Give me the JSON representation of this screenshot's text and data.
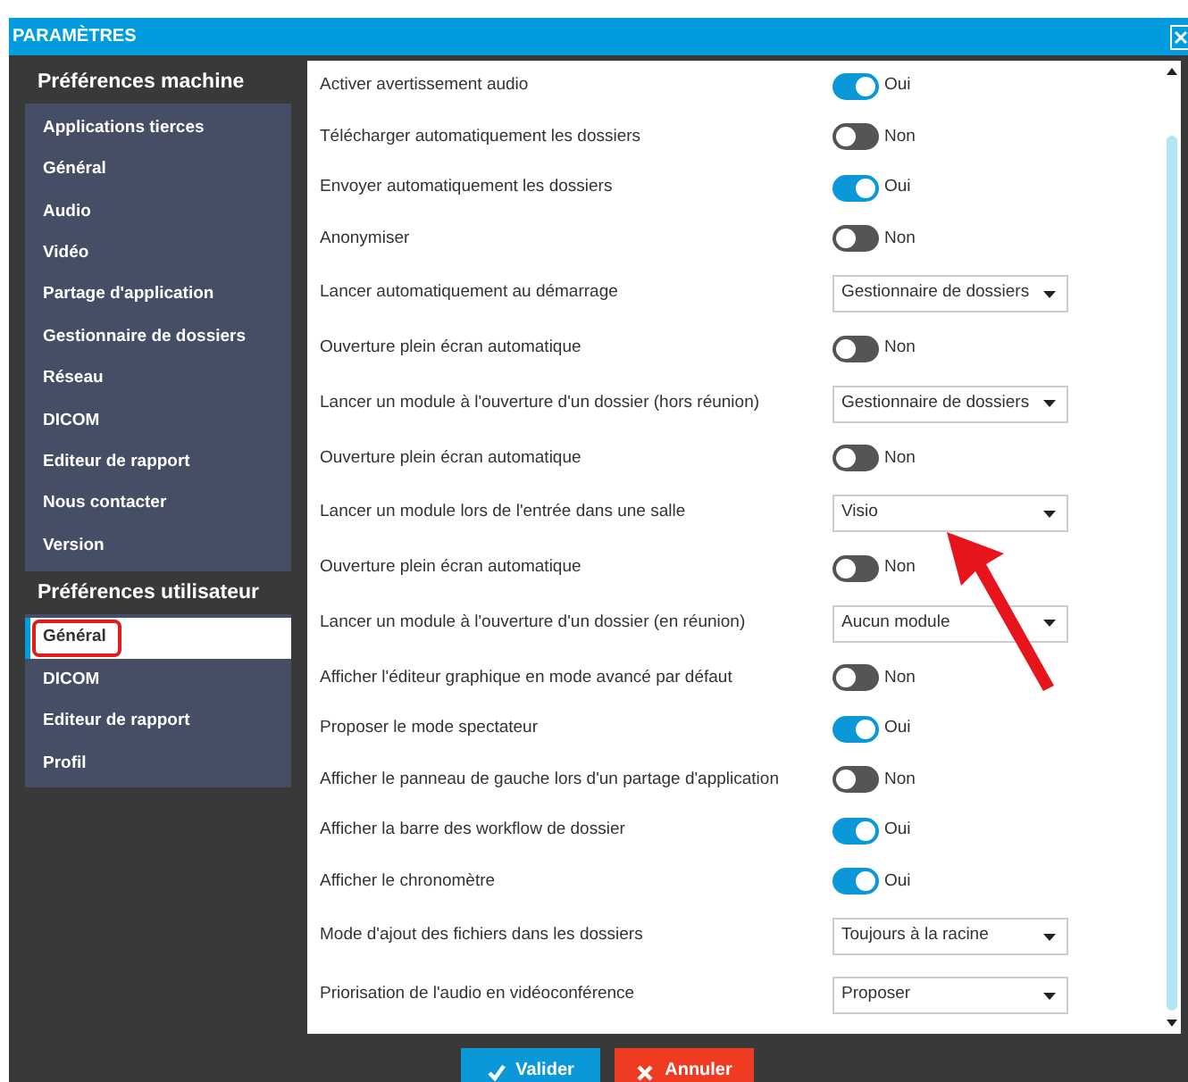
{
  "window": {
    "title": "PARAMÈTRES"
  },
  "sidebar": {
    "sections": [
      {
        "title": "Préférences machine",
        "items": [
          {
            "label": "Applications tierces",
            "selected": false
          },
          {
            "label": "Général",
            "selected": false
          },
          {
            "label": "Audio",
            "selected": false
          },
          {
            "label": "Vidéo",
            "selected": false
          },
          {
            "label": "Partage d'application",
            "selected": false
          },
          {
            "label": "Gestionnaire de dossiers",
            "selected": false
          },
          {
            "label": "Réseau",
            "selected": false
          },
          {
            "label": "DICOM",
            "selected": false
          },
          {
            "label": "Editeur de rapport",
            "selected": false
          },
          {
            "label": "Nous contacter",
            "selected": false
          },
          {
            "label": "Version",
            "selected": false
          }
        ]
      },
      {
        "title": "Préférences utilisateur",
        "items": [
          {
            "label": "Général",
            "selected": true
          },
          {
            "label": "DICOM",
            "selected": false
          },
          {
            "label": "Editeur de rapport",
            "selected": false
          },
          {
            "label": "Profil",
            "selected": false
          }
        ]
      }
    ]
  },
  "settings": [
    {
      "label": "Activer avertissement audio",
      "kind": "toggle",
      "on": true,
      "state_text": "Oui"
    },
    {
      "label": "Télécharger automatiquement les dossiers",
      "kind": "toggle",
      "on": false,
      "state_text": "Non"
    },
    {
      "label": "Envoyer automatiquement les dossiers",
      "kind": "toggle",
      "on": true,
      "state_text": "Oui"
    },
    {
      "label": "Anonymiser",
      "kind": "toggle",
      "on": false,
      "state_text": "Non"
    },
    {
      "label": "Lancer automatiquement au démarrage",
      "kind": "select",
      "value": "Gestionnaire de dossiers"
    },
    {
      "label": "Ouverture plein écran automatique",
      "kind": "toggle",
      "on": false,
      "state_text": "Non"
    },
    {
      "label": "Lancer un module à l'ouverture d'un dossier (hors réunion)",
      "kind": "select",
      "value": "Gestionnaire de dossiers"
    },
    {
      "label": "Ouverture plein écran automatique",
      "kind": "toggle",
      "on": false,
      "state_text": "Non"
    },
    {
      "label": "Lancer un module lors de l'entrée dans une salle",
      "kind": "select",
      "value": "Visio"
    },
    {
      "label": "Ouverture plein écran automatique",
      "kind": "toggle",
      "on": false,
      "state_text": "Non"
    },
    {
      "label": "Lancer un module à l'ouverture d'un dossier (en réunion)",
      "kind": "select",
      "value": "Aucun module"
    },
    {
      "label": "Afficher l'éditeur graphique en mode avancé par défaut",
      "kind": "toggle",
      "on": false,
      "state_text": "Non"
    },
    {
      "label": "Proposer le mode spectateur",
      "kind": "toggle",
      "on": true,
      "state_text": "Oui"
    },
    {
      "label": "Afficher le panneau de gauche lors d'un partage d'application",
      "kind": "toggle",
      "on": false,
      "state_text": "Non"
    },
    {
      "label": "Afficher la barre des workflow de dossier",
      "kind": "toggle",
      "on": true,
      "state_text": "Oui"
    },
    {
      "label": "Afficher le chronomètre",
      "kind": "toggle",
      "on": true,
      "state_text": "Oui"
    },
    {
      "label": "Mode d'ajout des fichiers dans les dossiers",
      "kind": "select",
      "value": "Toujours à la racine"
    },
    {
      "label": "Priorisation de l'audio en vidéoconférence",
      "kind": "select",
      "value": "Proposer"
    }
  ],
  "buttons": [
    {
      "label": "Valider",
      "kind": "confirm"
    },
    {
      "label": "Annuler",
      "kind": "cancel"
    }
  ],
  "annotations": {
    "highlight_box": true,
    "arrow": true
  }
}
